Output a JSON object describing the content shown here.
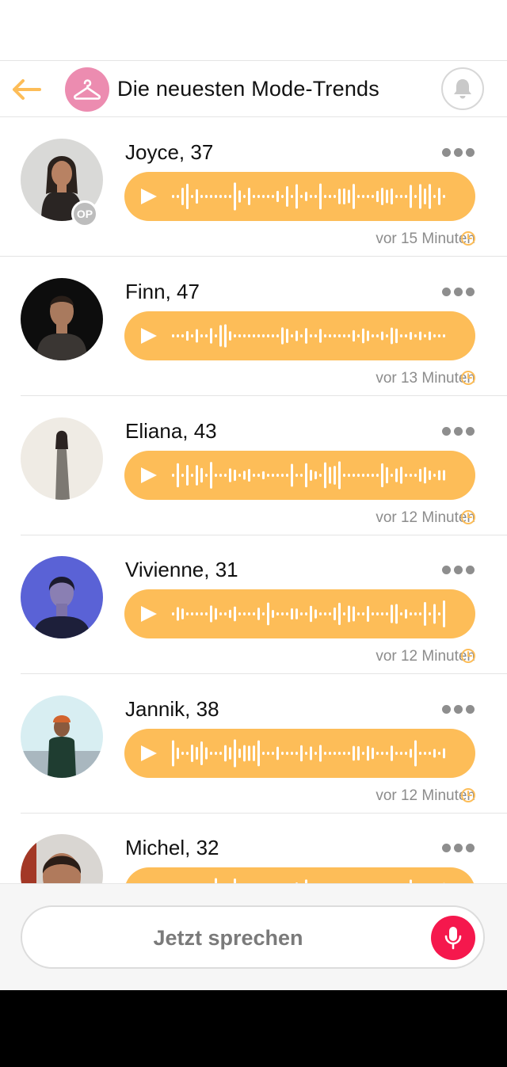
{
  "header": {
    "title": "Die neuesten Mode-Trends",
    "back_icon": "arrow-left-icon",
    "topic_icon": "hanger-icon",
    "bell_icon": "bell-icon",
    "accent_color": "#fdbd58",
    "topic_color": "#ec8cb0"
  },
  "posts": [
    {
      "name": "Joyce, 37",
      "time": "vor 15 Minuten",
      "op_badge": "OP"
    },
    {
      "name": "Finn, 47",
      "time": "vor 13 Minuten"
    },
    {
      "name": "Eliana, 43",
      "time": "vor 12 Minuten"
    },
    {
      "name": "Vivienne, 31",
      "time": "vor 12 Minuten"
    },
    {
      "name": "Jannik, 38",
      "time": "vor 12 Minuten"
    },
    {
      "name": "Michel, 32",
      "time": ""
    }
  ],
  "composer": {
    "label": "Jetzt sprechen",
    "mic_icon": "microphone-icon",
    "mic_color": "#f5184d"
  }
}
